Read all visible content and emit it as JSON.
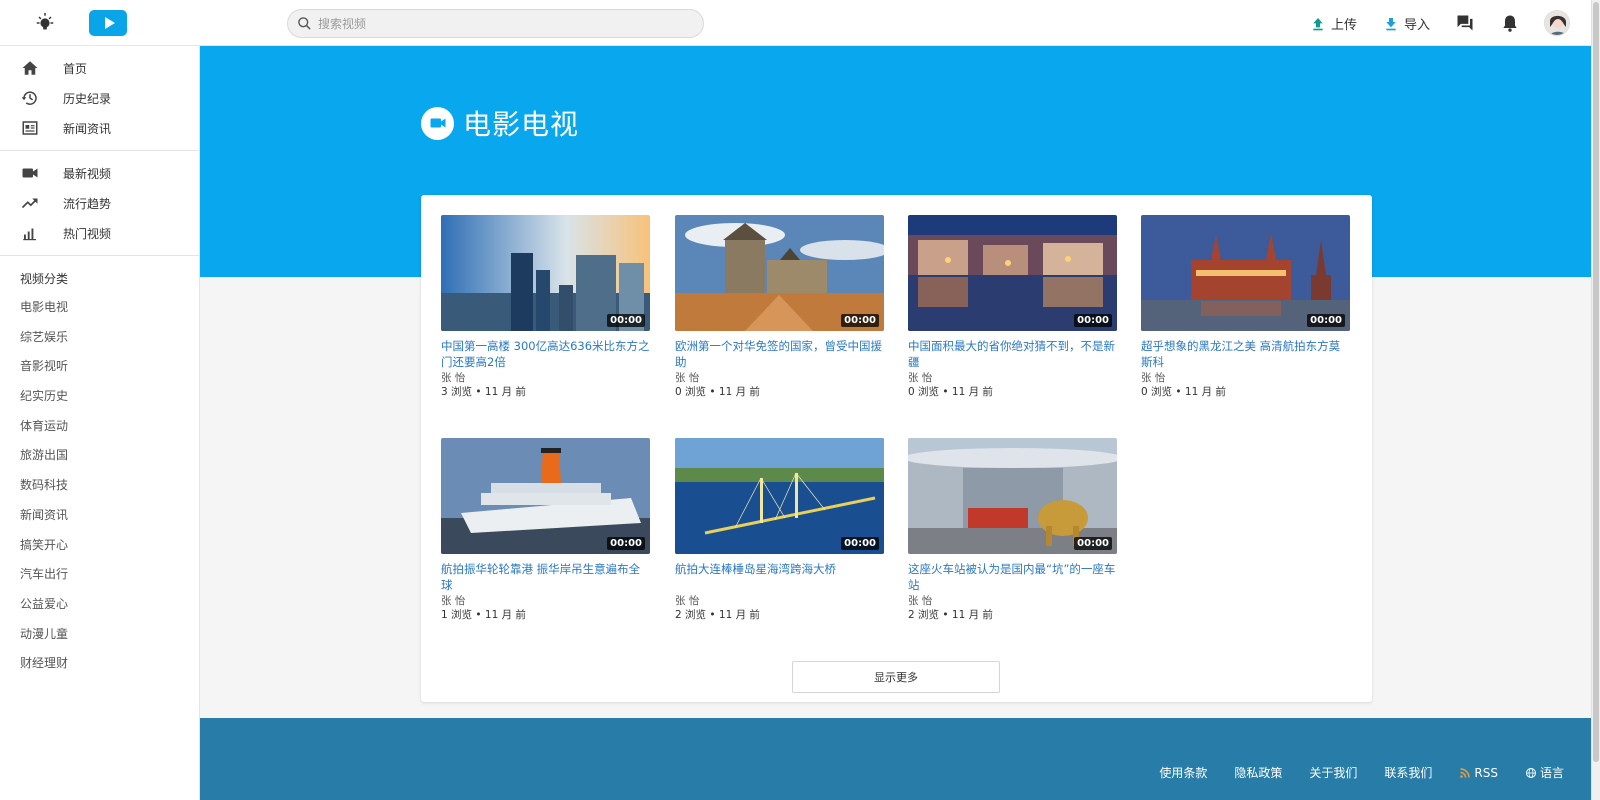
{
  "header": {
    "search_placeholder": "搜索视频",
    "upload_label": "上传",
    "import_label": "导入",
    "accent_color": "#0aa4e8"
  },
  "sidebar": {
    "main_nav": [
      {
        "label": "首页",
        "icon": "home-icon"
      },
      {
        "label": "历史纪录",
        "icon": "history-icon"
      },
      {
        "label": "新闻资讯",
        "icon": "news-icon"
      }
    ],
    "video_nav": [
      {
        "label": "最新视频",
        "icon": "video-camera-icon"
      },
      {
        "label": "流行趋势",
        "icon": "trending-icon"
      },
      {
        "label": "热门视频",
        "icon": "bar-chart-icon"
      }
    ],
    "category_heading": "视频分类",
    "categories": [
      "电影电视",
      "综艺娱乐",
      "音影视听",
      "纪实历史",
      "体育运动",
      "旅游出国",
      "数码科技",
      "新闻资讯",
      "搞笑开心",
      "汽车出行",
      "公益爱心",
      "动漫儿童",
      "财经理财"
    ]
  },
  "hero": {
    "title": "电影电视",
    "icon": "video-camera-icon",
    "background_color": "#08a7ee"
  },
  "videos": [
    {
      "title": "中国第一高楼 300亿高达636米比东方之门还要高2倍",
      "author": "张 怡",
      "meta": "3 浏览 • 11 月 前",
      "duration": "00:00"
    },
    {
      "title": "欧洲第一个对华免签的国家，曾受中国援助",
      "author": "张 怡",
      "meta": "0 浏览 • 11 月 前",
      "duration": "00:00"
    },
    {
      "title": "中国面积最大的省你绝对猜不到，不是新疆",
      "author": "张 怡",
      "meta": "0 浏览 • 11 月 前",
      "duration": "00:00"
    },
    {
      "title": "超乎想象的黑龙江之美 高清航拍东方莫斯科",
      "author": "张 怡",
      "meta": "0 浏览 • 11 月 前",
      "duration": "00:00"
    },
    {
      "title": "航拍振华轮轮靠港 振华岸吊生意遍布全球",
      "author": "张 怡",
      "meta": "1 浏览 • 11 月 前",
      "duration": "00:00"
    },
    {
      "title": "航拍大连棒棰岛星海湾跨海大桥",
      "author": "张 怡",
      "meta": "2 浏览 • 11 月 前",
      "duration": "00:00"
    },
    {
      "title": "这座火车站被认为是国内最“坑”的一座车站",
      "author": "张 怡",
      "meta": "2 浏览 • 11 月 前",
      "duration": "00:00"
    }
  ],
  "show_more_label": "显示更多",
  "footer": {
    "links": [
      "使用条款",
      "隐私政策",
      "关于我们",
      "联系我们"
    ],
    "rss_label": "RSS",
    "language_label": "语言",
    "background_color": "#277da8"
  }
}
